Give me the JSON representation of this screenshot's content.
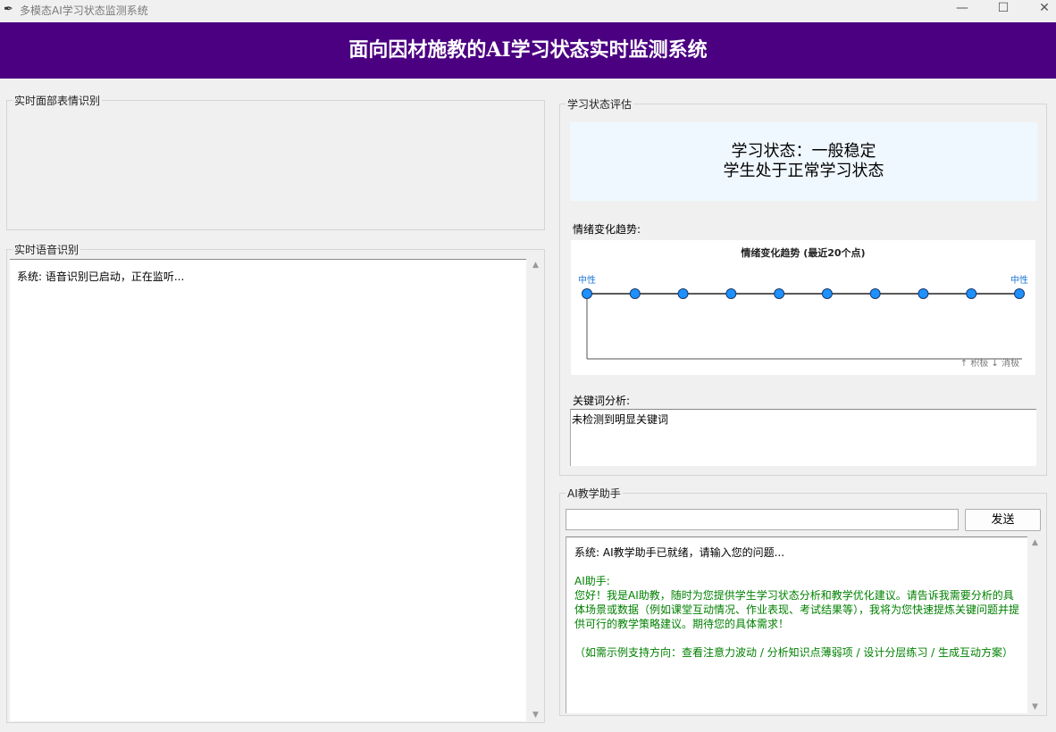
{
  "window": {
    "title": "多模态AI学习状态监测系统",
    "min_icon": "minimize-icon",
    "max_icon": "maximize-icon",
    "close_icon": "close-icon"
  },
  "banner": {
    "title": "面向因材施教的AI学习状态实时监测系统",
    "bg_color": "#4b0082"
  },
  "face_panel": {
    "label": "实时面部表情识别"
  },
  "voice_panel": {
    "label": "实时语音识别",
    "log": "系统: 语音识别已启动，正在监听..."
  },
  "eval_panel": {
    "label": "学习状态评估",
    "status_line1": "学习状态：一般稳定",
    "status_line2": "学生处于正常学习状态",
    "trend_label": "情绪变化趋势:",
    "keyword_label": "关键词分析:",
    "keyword_text": "未检测到明显关键词"
  },
  "chart_data": {
    "type": "line",
    "title": "情绪变化趋势 (最近20个点)",
    "x": [
      1,
      2,
      3,
      4,
      5,
      6,
      7,
      8,
      9,
      10
    ],
    "values": [
      0,
      0,
      0,
      0,
      0,
      0,
      0,
      0,
      0,
      0
    ],
    "point_labels": {
      "first": "中性",
      "last": "中性"
    },
    "legend_note": "↑ 积极 ↓ 消极",
    "point_color": "#1e90ff"
  },
  "ai_panel": {
    "label": "AI教学助手",
    "input_value": "",
    "send_label": "发送",
    "system_msg": "系统: AI教学助手已就绪，请输入您的问题...",
    "assistant_name": "AI助手:",
    "assistant_msg": "您好！我是AI助教，随时为您提供学生学习状态分析和教学优化建议。请告诉我需要分析的具体场景或数据（例如课堂互动情况、作业表现、考试结果等），我将为您快速提炼关键问题并提供可行的教学策略建议。期待您的具体需求！",
    "assistant_hint": "（如需示例支持方向：查看注意力波动 / 分析知识点薄弱项 / 设计分层练习 / 生成互动方案）"
  }
}
